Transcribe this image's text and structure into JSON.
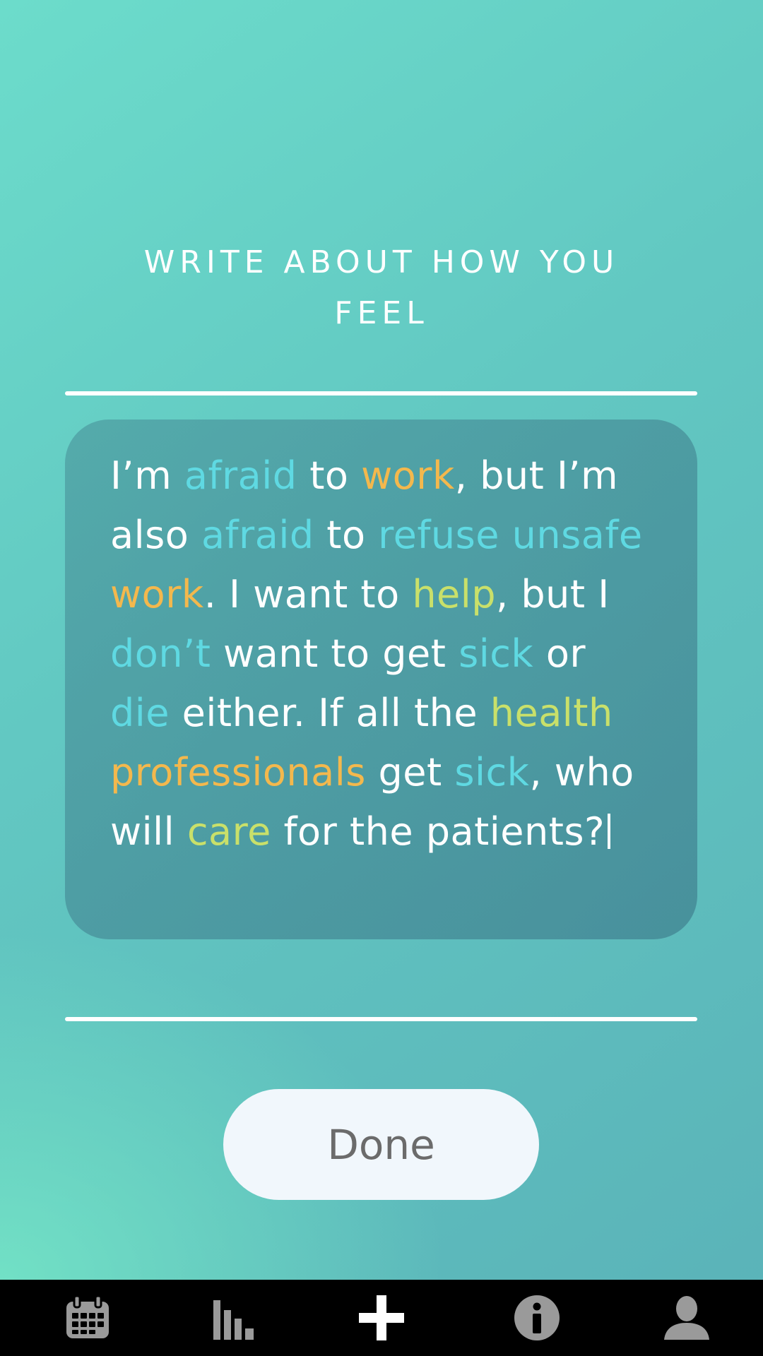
{
  "prompt": {
    "title": "WRITE ABOUT HOW YOU FEEL"
  },
  "entry": {
    "segments": [
      {
        "text": "I’m ",
        "tone": "plain"
      },
      {
        "text": "afraid",
        "tone": "blue"
      },
      {
        "text": " to ",
        "tone": "plain"
      },
      {
        "text": "work",
        "tone": "orange"
      },
      {
        "text": ", but I’m also ",
        "tone": "plain"
      },
      {
        "text": "afraid",
        "tone": "blue"
      },
      {
        "text": " to ",
        "tone": "plain"
      },
      {
        "text": "refuse unsafe",
        "tone": "blue"
      },
      {
        "text": " ",
        "tone": "plain"
      },
      {
        "text": "work",
        "tone": "orange"
      },
      {
        "text": ". I want to ",
        "tone": "plain"
      },
      {
        "text": "help",
        "tone": "green"
      },
      {
        "text": ", but I ",
        "tone": "plain"
      },
      {
        "text": "don’t",
        "tone": "blue"
      },
      {
        "text": " want to get ",
        "tone": "plain"
      },
      {
        "text": "sick",
        "tone": "blue"
      },
      {
        "text": " or ",
        "tone": "plain"
      },
      {
        "text": "die",
        "tone": "blue"
      },
      {
        "text": " either. If all the ",
        "tone": "plain"
      },
      {
        "text": "health",
        "tone": "green"
      },
      {
        "text": " ",
        "tone": "plain"
      },
      {
        "text": "professionals",
        "tone": "orange"
      },
      {
        "text": " get ",
        "tone": "plain"
      },
      {
        "text": "sick",
        "tone": "blue"
      },
      {
        "text": ", who will ",
        "tone": "plain"
      },
      {
        "text": "care",
        "tone": "green"
      },
      {
        "text": " for the patients?",
        "tone": "plain"
      }
    ]
  },
  "colors": {
    "plain": "#ffffff",
    "blue": "#5fd9e2",
    "orange": "#f3b84d",
    "green": "#c9e06a"
  },
  "actions": {
    "done_label": "Done"
  },
  "tabbar": {
    "items": [
      {
        "icon": "calendar-icon"
      },
      {
        "icon": "bar-chart-icon"
      },
      {
        "icon": "plus-icon"
      },
      {
        "icon": "info-icon"
      },
      {
        "icon": "person-icon"
      }
    ]
  }
}
